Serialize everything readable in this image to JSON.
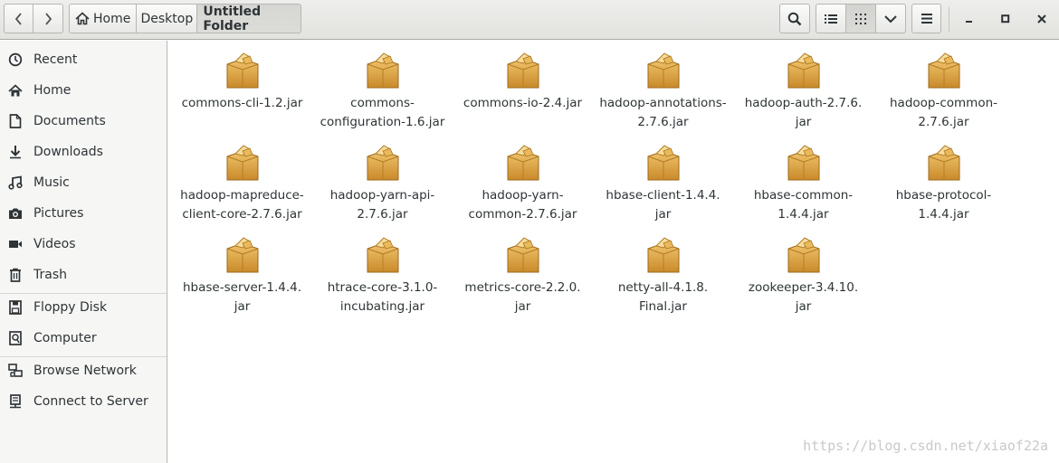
{
  "header": {
    "breadcrumbs": [
      {
        "label": "Home"
      },
      {
        "label": "Desktop"
      },
      {
        "label": "Untitled Folder"
      }
    ]
  },
  "sidebar": {
    "places": [
      {
        "label": "Recent",
        "icon": "clock-icon"
      },
      {
        "label": "Home",
        "icon": "home-icon"
      },
      {
        "label": "Documents",
        "icon": "document-icon"
      },
      {
        "label": "Downloads",
        "icon": "download-icon"
      },
      {
        "label": "Music",
        "icon": "music-icon"
      },
      {
        "label": "Pictures",
        "icon": "camera-icon"
      },
      {
        "label": "Videos",
        "icon": "video-icon"
      },
      {
        "label": "Trash",
        "icon": "trash-icon"
      }
    ],
    "devices": [
      {
        "label": "Floppy Disk",
        "icon": "floppy-icon"
      },
      {
        "label": "Computer",
        "icon": "computer-icon"
      }
    ],
    "network": [
      {
        "label": "Browse Network",
        "icon": "network-icon"
      },
      {
        "label": "Connect to Server",
        "icon": "server-icon"
      }
    ]
  },
  "files": [
    {
      "line1": "commons-cli-1.2.jar",
      "line2": ""
    },
    {
      "line1": "commons-",
      "line2": "configuration-1.6.jar"
    },
    {
      "line1": "commons-io-2.4.jar",
      "line2": ""
    },
    {
      "line1": "hadoop-annotations-",
      "line2": "2.7.6.jar"
    },
    {
      "line1": "hadoop-auth-2.7.6.",
      "line2": "jar"
    },
    {
      "line1": "hadoop-common-",
      "line2": "2.7.6.jar"
    },
    {
      "line1": "hadoop-mapreduce-",
      "line2": "client-core-2.7.6.jar"
    },
    {
      "line1": "hadoop-yarn-api-",
      "line2": "2.7.6.jar"
    },
    {
      "line1": "hadoop-yarn-",
      "line2": "common-2.7.6.jar"
    },
    {
      "line1": "hbase-client-1.4.4.",
      "line2": "jar"
    },
    {
      "line1": "hbase-common-",
      "line2": "1.4.4.jar"
    },
    {
      "line1": "hbase-protocol-",
      "line2": "1.4.4.jar"
    },
    {
      "line1": "hbase-server-1.4.4.",
      "line2": "jar"
    },
    {
      "line1": "htrace-core-3.1.0-",
      "line2": "incubating.jar"
    },
    {
      "line1": "metrics-core-2.2.0.",
      "line2": "jar"
    },
    {
      "line1": "netty-all-4.1.8.",
      "line2": "Final.jar"
    },
    {
      "line1": "zookeeper-3.4.10.",
      "line2": "jar"
    }
  ],
  "watermark": "https://blog.csdn.net/xiaof22a",
  "colors": {
    "package_light": "#f0c46c",
    "package_dark": "#c98a2a",
    "accent": "#2e3436"
  }
}
